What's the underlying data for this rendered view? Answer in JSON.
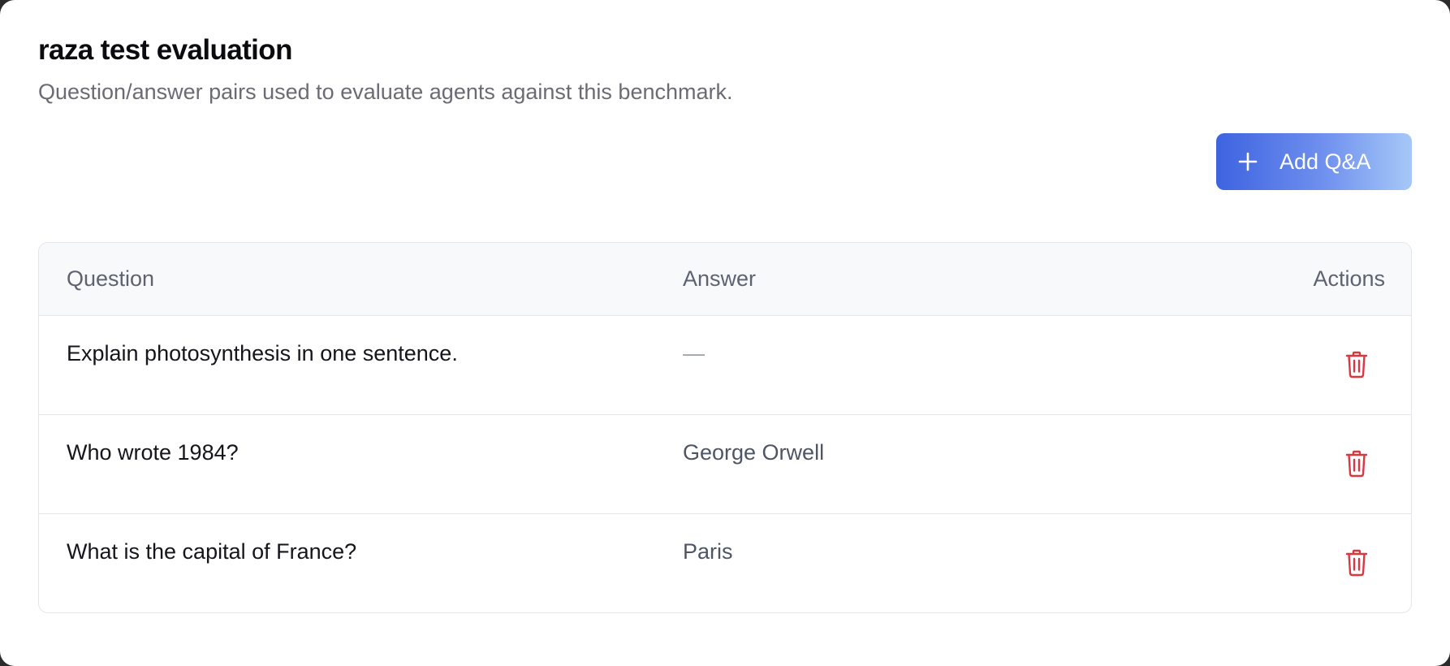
{
  "header": {
    "title": "raza test evaluation",
    "subtitle": "Question/answer pairs used to evaluate agents against this benchmark."
  },
  "toolbar": {
    "add_label": "Add Q&A",
    "add_icon": "plus-icon"
  },
  "table": {
    "columns": {
      "question": "Question",
      "answer": "Answer",
      "actions": "Actions"
    },
    "rows": [
      {
        "question": "Explain photosynthesis in one sentence.",
        "answer": "—"
      },
      {
        "question": "Who wrote 1984?",
        "answer": "George Orwell"
      },
      {
        "question": "What is the capital of France?",
        "answer": "Paris"
      }
    ],
    "delete_icon": "trash-icon",
    "delete_color": "#d9393e"
  },
  "colors": {
    "accent_start": "#3d63e0",
    "accent_end": "#a6c8f7"
  }
}
